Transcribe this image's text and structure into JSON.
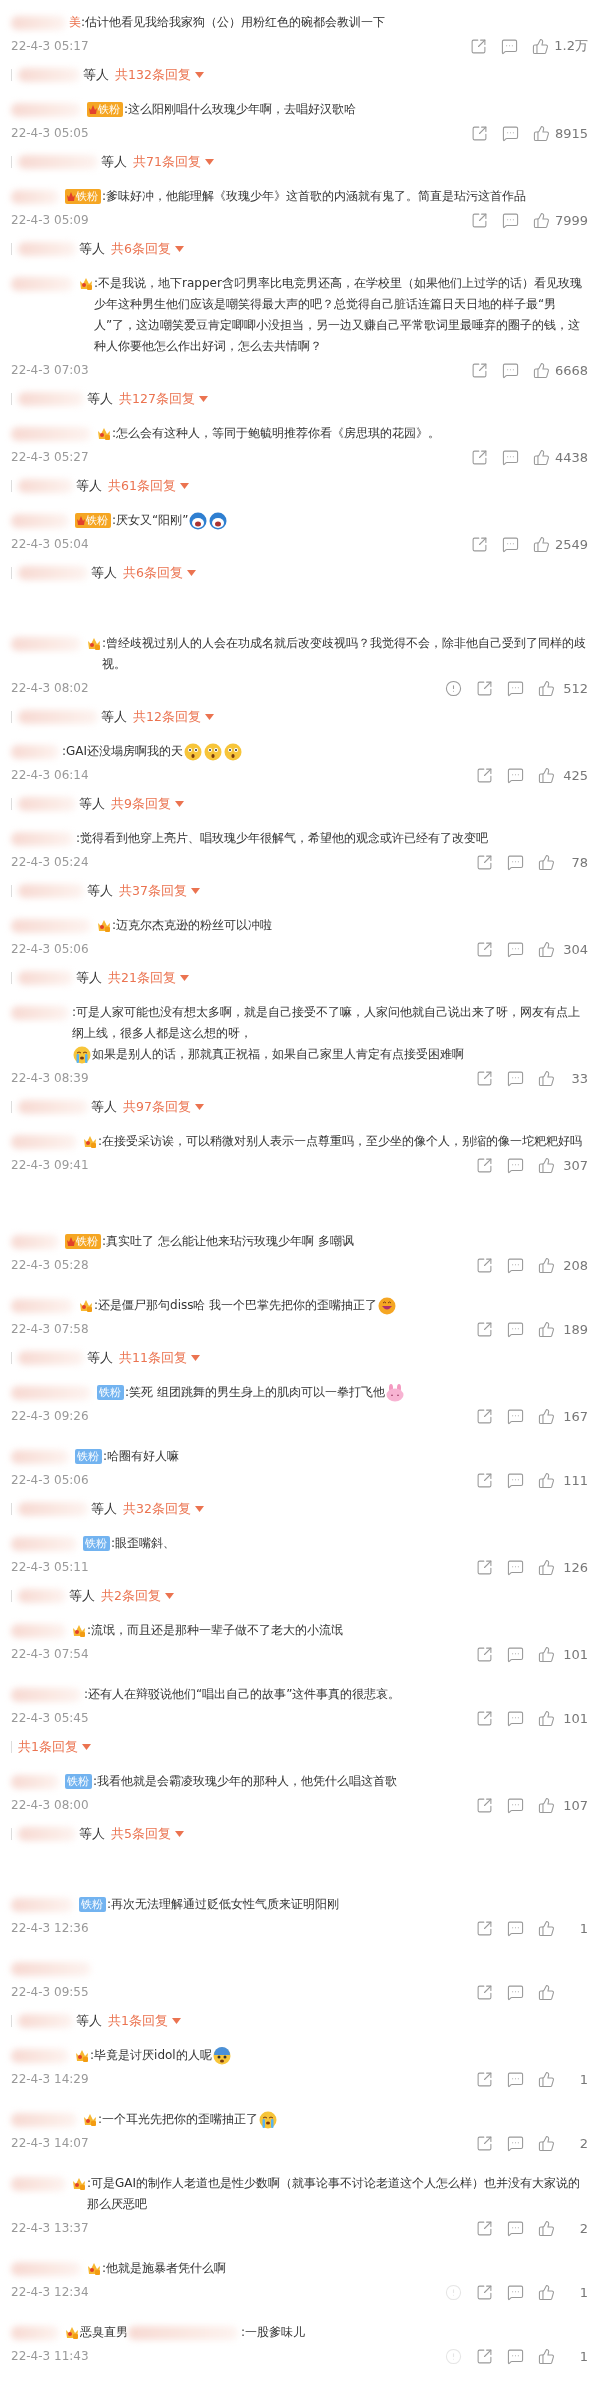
{
  "sections": [
    {
      "comments": [
        {
          "name_visible": "美",
          "badge": {
            "kind": "none"
          },
          "content": [
            {
              "kind": "text",
              "text": ":估计他看见我给我家狗（公）用粉红色的碗都会教训一下"
            }
          ],
          "time": "22-4-3 05:17",
          "likes": "1.2万",
          "replies": {
            "others": "等人",
            "count": "共132条回复"
          }
        },
        {
          "badge": {
            "kind": "fan-orange",
            "label": "铁粉"
          },
          "content": [
            {
              "kind": "text",
              "text": ":这么阳刚唱什么玫瑰少年啊，去唱好汉歌哈"
            }
          ],
          "time": "22-4-3 05:05",
          "likes": "8915",
          "replies": {
            "others": "等人",
            "count": "共71条回复"
          }
        },
        {
          "badge": {
            "kind": "fan-orange",
            "label": "铁粉"
          },
          "content": [
            {
              "kind": "text",
              "text": ":爹味好冲，他能理解《玫瑰少年》这首歌的内涵就有鬼了。简直是玷污这首作品"
            }
          ],
          "time": "22-4-3 05:09",
          "likes": "7999",
          "replies": {
            "others": "等人",
            "count": "共6条回复"
          }
        },
        {
          "badge": {
            "kind": "crown"
          },
          "content": [
            {
              "kind": "text",
              "text": ":不是我说，地下rapper含叼男率比电竞男还高，在学校里（如果他们上过学的话）看见玫瑰少年这种男生他们应该是嘲笑得最大声的吧？总觉得自己脏话连篇日天日地的样子最“男人”了，这边嘲笑爱豆肯定唧唧小没担当，另一边又赚自己平常歌词里最唾弃的圈子的钱，这种人你要他怎么作出好词，怎么去共情啊？"
            }
          ],
          "time": "22-4-3 07:03",
          "likes": "6668",
          "replies": {
            "others": "等人",
            "count": "共127条回复"
          }
        },
        {
          "badge": {
            "kind": "crown"
          },
          "content": [
            {
              "kind": "text",
              "text": ":怎么会有这种人，等同于鲍毓明推荐你看《房思琪的花园》。"
            }
          ],
          "time": "22-4-3 05:27",
          "likes": "4438",
          "replies": {
            "others": "等人",
            "count": "共61条回复"
          }
        },
        {
          "badge": {
            "kind": "fan-orange",
            "label": "铁粉"
          },
          "content": [
            {
              "kind": "text",
              "text": ":厌女又“阳刚”"
            },
            {
              "kind": "shouting"
            },
            {
              "kind": "shouting"
            }
          ],
          "time": "22-4-3 05:04",
          "likes": "2549",
          "replies": {
            "others": "等人",
            "count": "共6条回复"
          }
        }
      ]
    },
    {
      "comments": [
        {
          "badge": {
            "kind": "crown"
          },
          "content": [
            {
              "kind": "text",
              "text": ":曾经歧视过别人的人会在功成名就后改变歧视吗？我觉得不会，除非他自己受到了同样的歧视。"
            }
          ],
          "time": "22-4-3 08:02",
          "report": {
            "dim": false
          },
          "likes": "512",
          "replies": {
            "others": "等人",
            "count": "共12条回复"
          }
        },
        {
          "badge": {
            "kind": "none"
          },
          "content": [
            {
              "kind": "text",
              "text": ":GAI还没塌房啊我的天"
            },
            {
              "kind": "surprised"
            },
            {
              "kind": "surprised"
            },
            {
              "kind": "surprised"
            }
          ],
          "time": "22-4-3 06:14",
          "likes": "425",
          "replies": {
            "others": "等人",
            "count": "共9条回复"
          }
        },
        {
          "badge": {
            "kind": "none"
          },
          "content": [
            {
              "kind": "text",
              "text": ":觉得看到他穿上亮片、唱玫瑰少年很解气，希望他的观念或许已经有了改变吧"
            }
          ],
          "time": "22-4-3 05:24",
          "likes": "78",
          "replies": {
            "others": "等人",
            "count": "共37条回复"
          }
        },
        {
          "badge": {
            "kind": "crown"
          },
          "content": [
            {
              "kind": "text",
              "text": ":迈克尔杰克逊的粉丝可以冲啦"
            }
          ],
          "time": "22-4-3 05:06",
          "likes": "304",
          "replies": {
            "others": "等人",
            "count": "共21条回复"
          }
        },
        {
          "badge": {
            "kind": "none"
          },
          "content": [
            {
              "kind": "text",
              "text": ":可是人家可能也没有想太多啊，就是自己接受不了嘛，人家问他就自己说出来了呀，网友有点上纲上线，很多人都是这么想的呀，"
            },
            {
              "kind": "crying"
            },
            {
              "kind": "text",
              "text": "如果是别人的话，那就真正祝福，如果自己家里人肯定有点接受困难啊"
            }
          ],
          "time": "22-4-3 08:39",
          "likes": "33",
          "replies": {
            "others": "等人",
            "count": "共97条回复"
          }
        },
        {
          "badge": {
            "kind": "crown"
          },
          "content": [
            {
              "kind": "text",
              "text": ":在接受采访诶，可以稍微对别人表示一点尊重吗，至少坐的像个人，别缩的像一坨粑粑好吗"
            }
          ],
          "time": "22-4-3 09:41",
          "likes": "307"
        }
      ]
    },
    {
      "comments": [
        {
          "badge": {
            "kind": "fan-orange",
            "label": "铁粉"
          },
          "content": [
            {
              "kind": "text",
              "text": ":真实吐了 怎么能让他来玷污玫瑰少年啊 多嘲讽"
            }
          ],
          "time": "22-4-3 05:28",
          "likes": "208"
        },
        {
          "badge": {
            "kind": "crown"
          },
          "content": [
            {
              "kind": "text",
              "text": ":还是僵尸那句diss哈 我一个巴掌先把你的歪嘴抽正了"
            },
            {
              "kind": "grin"
            }
          ],
          "time": "22-4-3 07:58",
          "likes": "189",
          "replies": {
            "others": "等人",
            "count": "共11条回复"
          }
        },
        {
          "badge": {
            "kind": "fan-blue",
            "label": "铁粉"
          },
          "content": [
            {
              "kind": "text",
              "text": ":笑死 组团跳舞的男生身上的肌肉可以一拳打飞他"
            },
            {
              "kind": "bunny"
            }
          ],
          "time": "22-4-3 09:26",
          "likes": "167"
        },
        {
          "badge": {
            "kind": "fan-blue",
            "label": "铁粉"
          },
          "content": [
            {
              "kind": "text",
              "text": ":哈圈有好人嘛"
            }
          ],
          "time": "22-4-3 05:06",
          "likes": "111",
          "replies": {
            "others": "等人",
            "count": "共32条回复"
          }
        },
        {
          "badge": {
            "kind": "fan-blue",
            "label": "铁粉"
          },
          "content": [
            {
              "kind": "text",
              "text": ":眼歪嘴斜、"
            }
          ],
          "time": "22-4-3 05:11",
          "likes": "126",
          "replies": {
            "others": "等人",
            "count": "共2条回复"
          }
        },
        {
          "badge": {
            "kind": "crown"
          },
          "content": [
            {
              "kind": "text",
              "text": ":流氓，而且还是那种一辈子做不了老大的小流氓"
            }
          ],
          "time": "22-4-3 07:54",
          "likes": "101"
        },
        {
          "badge": {
            "kind": "none"
          },
          "content": [
            {
              "kind": "text",
              "text": ":还有人在辩驳说他们“唱出自己的故事”这件事真的很悲哀。"
            }
          ],
          "time": "22-4-3 05:45",
          "likes": "101",
          "replies": {
            "count": "共1条回复"
          }
        },
        {
          "badge": {
            "kind": "fan-blue",
            "label": "铁粉"
          },
          "content": [
            {
              "kind": "text",
              "text": ":我看他就是会霸凌玫瑰少年的那种人，他凭什么唱这首歌"
            }
          ],
          "time": "22-4-3 08:00",
          "likes": "107",
          "replies": {
            "others": "等人",
            "count": "共5条回复"
          }
        }
      ]
    },
    {
      "comments": [
        {
          "badge": {
            "kind": "fan-blue",
            "label": "铁粉"
          },
          "content": [
            {
              "kind": "text",
              "text": ":再次无法理解通过贬低女性气质来证明阳刚"
            }
          ],
          "time": "22-4-3 12:36",
          "likes": "1"
        },
        {
          "badge": {
            "kind": "none"
          },
          "time": "22-4-3 09:55",
          "replies": {
            "others": "等人",
            "count": "共1条回复"
          }
        },
        {
          "badge": {
            "kind": "crown"
          },
          "content": [
            {
              "kind": "text",
              "text": ":毕竟是讨厌idol的人呢"
            },
            {
              "kind": "scared"
            }
          ],
          "time": "22-4-3 14:29",
          "likes": "1"
        },
        {
          "badge": {
            "kind": "crown"
          },
          "content": [
            {
              "kind": "text",
              "text": ":一个耳光先把你的歪嘴抽正了"
            },
            {
              "kind": "crying"
            }
          ],
          "time": "22-4-3 14:07",
          "likes": "2"
        },
        {
          "badge": {
            "kind": "crown"
          },
          "content": [
            {
              "kind": "text",
              "text": ":可是GAI的制作人老道也是性少数啊（就事论事不讨论老道这个人怎么样）也并没有大家说的那么厌恶吧"
            }
          ],
          "time": "22-4-3 13:37",
          "likes": "2"
        },
        {
          "badge": {
            "kind": "crown"
          },
          "content": [
            {
              "kind": "text",
              "text": ":他就是施暴者凭什么啊"
            }
          ],
          "time": "22-4-3 12:34",
          "report": {
            "dim": true
          },
          "likes": "1"
        },
        {
          "badge": {
            "kind": "crown"
          },
          "content": [
            {
              "kind": "text",
              "text": "恶臭直男"
            },
            {
              "kind": "blur"
            },
            {
              "kind": "text",
              "text": ":一股爹味儿"
            }
          ],
          "time": "22-4-3 11:43",
          "report": {
            "dim": true
          },
          "likes": "1"
        }
      ]
    }
  ]
}
